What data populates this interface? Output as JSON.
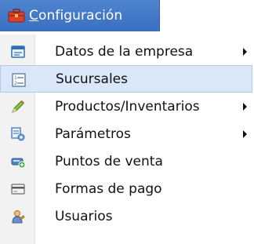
{
  "menubar": {
    "title_accel": "C",
    "title_rest": "onfiguración",
    "icon": "toolbox-icon"
  },
  "menu": {
    "items": [
      {
        "label": "Datos de la empresa",
        "icon": "company-data-icon",
        "has_submenu": true,
        "highlighted": false
      },
      {
        "label": "Sucursales",
        "icon": "branches-list-icon",
        "has_submenu": false,
        "highlighted": true
      },
      {
        "label": "Productos/Inventarios",
        "icon": "pencil-icon",
        "has_submenu": true,
        "highlighted": false
      },
      {
        "label": "Parámetros",
        "icon": "parameters-icon",
        "has_submenu": true,
        "highlighted": false
      },
      {
        "label": "Puntos de venta",
        "icon": "point-of-sale-icon",
        "has_submenu": false,
        "highlighted": false
      },
      {
        "label": "Formas de pago",
        "icon": "payment-card-icon",
        "has_submenu": false,
        "highlighted": false
      },
      {
        "label": "Usuarios",
        "icon": "users-icon",
        "has_submenu": false,
        "highlighted": false
      }
    ]
  },
  "colors": {
    "menubar_active": "#3b6fc0",
    "highlight_bg": "#d9e7f8",
    "highlight_border": "#aecbee"
  }
}
